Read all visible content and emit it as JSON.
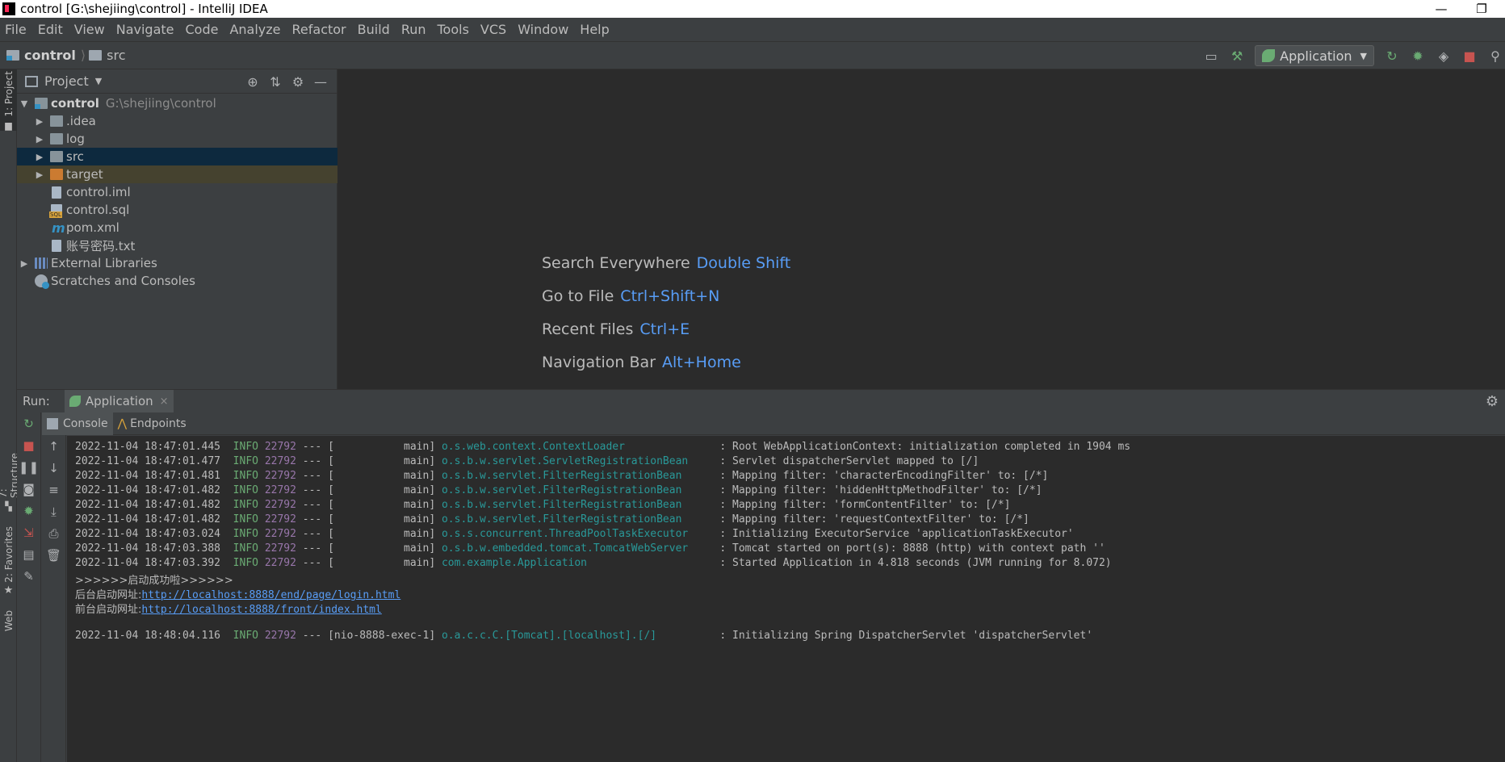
{
  "window": {
    "title": "control [G:\\shejiing\\control] - IntelliJ IDEA",
    "minimize": "—",
    "restore": "❐"
  },
  "menu": [
    "File",
    "Edit",
    "View",
    "Navigate",
    "Code",
    "Analyze",
    "Refactor",
    "Build",
    "Run",
    "Tools",
    "VCS",
    "Window",
    "Help"
  ],
  "breadcrumb": {
    "project": "control",
    "folder": "src"
  },
  "toolbar": {
    "run_config": "Application"
  },
  "sidebar_tabs": {
    "project": "1: Project",
    "structure": "7: Structure",
    "favorites": "2: Favorites",
    "web": "Web"
  },
  "project_panel": {
    "title": "Project",
    "tree": [
      {
        "label": "control",
        "path": "G:\\shejiing\\control",
        "expanded": true
      },
      {
        "label": ".idea"
      },
      {
        "label": "log"
      },
      {
        "label": "src"
      },
      {
        "label": "target"
      },
      {
        "label": "control.iml"
      },
      {
        "label": "control.sql"
      },
      {
        "label": "pom.xml"
      },
      {
        "label": "账号密码.txt"
      },
      {
        "label": "External Libraries"
      },
      {
        "label": "Scratches and Consoles"
      }
    ]
  },
  "editor_hints": [
    {
      "label": "Search Everywhere",
      "key": "Double Shift"
    },
    {
      "label": "Go to File",
      "key": "Ctrl+Shift+N"
    },
    {
      "label": "Recent Files",
      "key": "Ctrl+E"
    },
    {
      "label": "Navigation Bar",
      "key": "Alt+Home"
    }
  ],
  "run_panel": {
    "label": "Run:",
    "tab": "Application",
    "close": "×",
    "subtabs": {
      "console": "Console",
      "endpoints": "Endpoints"
    }
  },
  "console_logs": [
    {
      "ts": "2022-11-04 18:47:01.445",
      "level": "INFO",
      "pid": "22792",
      "sep": "---",
      "thread": "[           main]",
      "logger": "o.s.web.context.ContextLoader           ",
      "msg": ": Root WebApplicationContext: initialization completed in 1904 ms"
    },
    {
      "ts": "2022-11-04 18:47:01.477",
      "level": "INFO",
      "pid": "22792",
      "sep": "---",
      "thread": "[           main]",
      "logger": "o.s.b.w.servlet.ServletRegistrationBean ",
      "msg": ": Servlet dispatcherServlet mapped to [/]"
    },
    {
      "ts": "2022-11-04 18:47:01.481",
      "level": "INFO",
      "pid": "22792",
      "sep": "---",
      "thread": "[           main]",
      "logger": "o.s.b.w.servlet.FilterRegistrationBean  ",
      "msg": ": Mapping filter: 'characterEncodingFilter' to: [/*]"
    },
    {
      "ts": "2022-11-04 18:47:01.482",
      "level": "INFO",
      "pid": "22792",
      "sep": "---",
      "thread": "[           main]",
      "logger": "o.s.b.w.servlet.FilterRegistrationBean  ",
      "msg": ": Mapping filter: 'hiddenHttpMethodFilter' to: [/*]"
    },
    {
      "ts": "2022-11-04 18:47:01.482",
      "level": "INFO",
      "pid": "22792",
      "sep": "---",
      "thread": "[           main]",
      "logger": "o.s.b.w.servlet.FilterRegistrationBean  ",
      "msg": ": Mapping filter: 'formContentFilter' to: [/*]"
    },
    {
      "ts": "2022-11-04 18:47:01.482",
      "level": "INFO",
      "pid": "22792",
      "sep": "---",
      "thread": "[           main]",
      "logger": "o.s.b.w.servlet.FilterRegistrationBean  ",
      "msg": ": Mapping filter: 'requestContextFilter' to: [/*]"
    },
    {
      "ts": "2022-11-04 18:47:03.024",
      "level": "INFO",
      "pid": "22792",
      "sep": "---",
      "thread": "[           main]",
      "logger": "o.s.s.concurrent.ThreadPoolTaskExecutor ",
      "msg": ": Initializing ExecutorService 'applicationTaskExecutor'"
    },
    {
      "ts": "2022-11-04 18:47:03.388",
      "level": "INFO",
      "pid": "22792",
      "sep": "---",
      "thread": "[           main]",
      "logger": "o.s.b.w.embedded.tomcat.TomcatWebServer ",
      "msg": ": Tomcat started on port(s): 8888 (http) with context path ''"
    },
    {
      "ts": "2022-11-04 18:47:03.392",
      "level": "INFO",
      "pid": "22792",
      "sep": "---",
      "thread": "[           main]",
      "logger": "com.example.Application                 ",
      "msg": ": Started Application in 4.818 seconds (JVM running for 8.072)"
    }
  ],
  "console_text": {
    "success": ">>>>>>启动成功啦>>>>>>",
    "admin_label": "后台启动网址:",
    "admin_url": "http://localhost:8888/end/page/login.html",
    "front_label": "前台启动网址:",
    "front_url": "http://localhost:8888/front/index.html"
  },
  "console_last": {
    "ts": "2022-11-04 18:48:04.116",
    "level": "INFO",
    "pid": "22792",
    "sep": "---",
    "thread": "[nio-8888-exec-1]",
    "logger": "o.a.c.c.C.[Tomcat].[localhost].[/]      ",
    "msg": ": Initializing Spring DispatcherServlet 'dispatcherServlet'"
  }
}
